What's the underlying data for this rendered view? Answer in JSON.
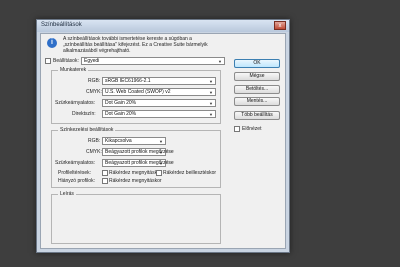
{
  "window": {
    "title": "Színbeállítások",
    "close_label": "x"
  },
  "description": [
    "A színbeállítások további ismertetése kereste a súgóban a",
    "„színbeállítás beállítása\" kifejezést. Ez a Creative Suite bármelyik",
    "alkalmazásából végrehajtható."
  ],
  "settings": {
    "label": "Beállítások:",
    "value": "Egyedi"
  },
  "workspaces": {
    "title": "Munkaterek",
    "rows": [
      {
        "label": "RGB:",
        "value": "sRGB IEC61966-2.1"
      },
      {
        "label": "CMYK:",
        "value": "U.S. Web Coated (SWOP) v2"
      },
      {
        "label": "Szürkeárnyalatos:",
        "value": "Dot Gain 20%"
      },
      {
        "label": "Direktszín:",
        "value": "Dot Gain 20%"
      }
    ]
  },
  "policies": {
    "title": "Színkezelési beállítások",
    "rows": [
      {
        "label": "RGB:",
        "value": "Kikapcsolva"
      },
      {
        "label": "CMYK:",
        "value": "Beágyazott profilok megőrzése"
      },
      {
        "label": "Szürkeárnyalatos:",
        "value": "Beágyazott profilok megőrzése"
      }
    ],
    "mismatch_label": "Profileltérések:",
    "missing_label": "Hiányzó profilok:",
    "ask_open": "Rákérdez megnyitáskor",
    "ask_paste": "Rákérdez beillesztéskor",
    "ask_open2": "Rákérdez megnyitáskor"
  },
  "description_group": {
    "title": "Leírás"
  },
  "buttons": {
    "ok": "OK",
    "cancel": "Mégse",
    "load": "Betöltés...",
    "save": "Mentés...",
    "more": "Több beállítás"
  },
  "preview_label": "Előnézet"
}
